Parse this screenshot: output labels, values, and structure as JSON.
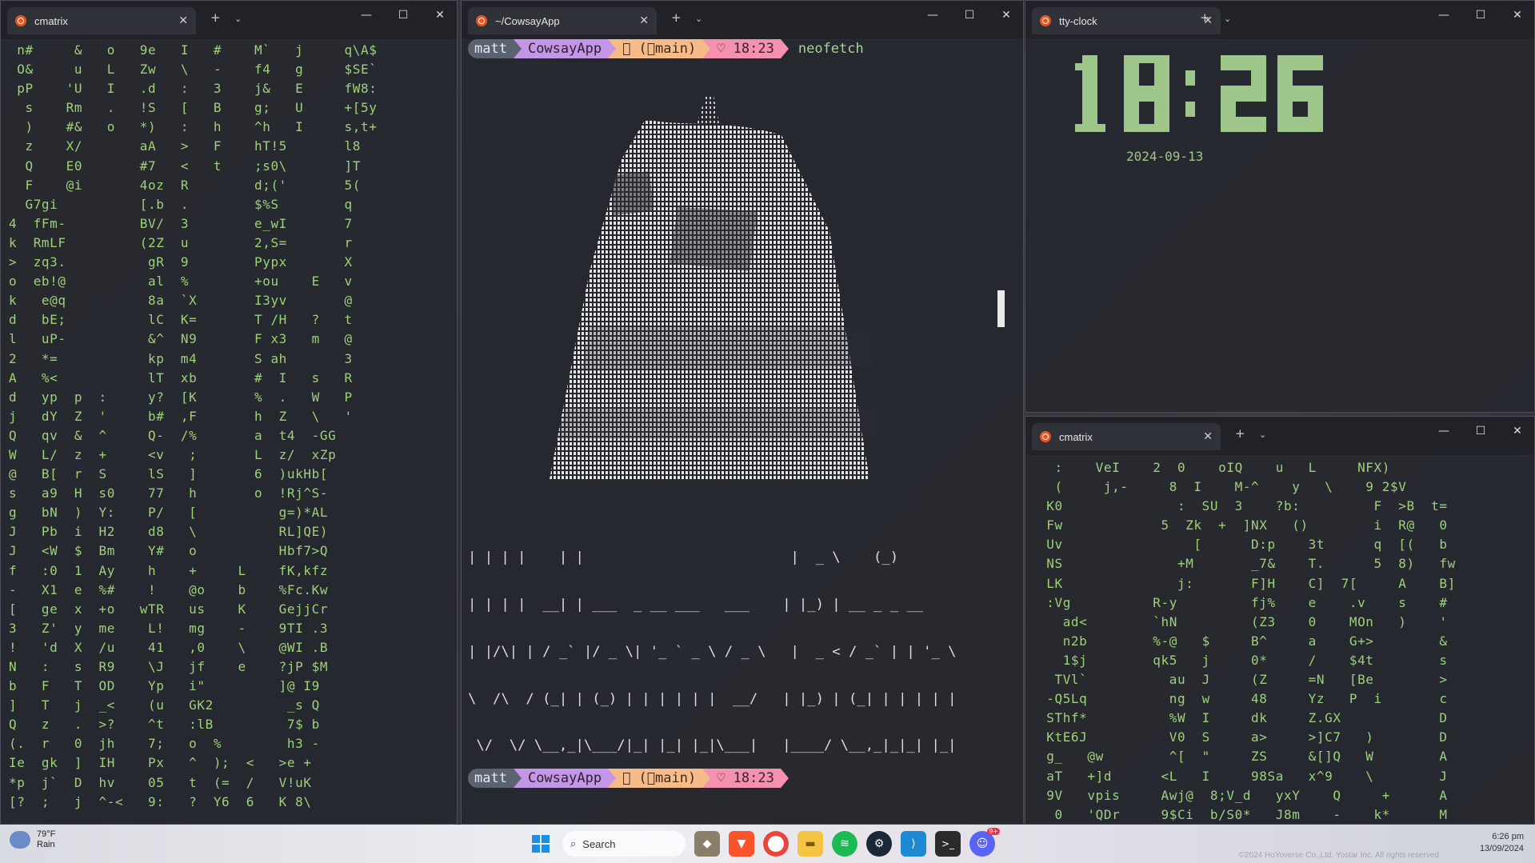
{
  "wallpaper": {
    "watermark": "©2024 HoYoverse Co.,Ltd. Yostar Inc. All rights reserved"
  },
  "windows": {
    "left": {
      "tab_title": "cmatrix",
      "lines": [
        " n#     &   o   9e   I   #    M`   j     q\\A$",
        " O&     u   L   Zw   \\   -    f4   g     $SE`",
        " pP    'U   I   .d   :   3    j&   E     fW8:",
        "  s    Rm   .   !S   [   B    g;   U     +[5y",
        "  )    #&   o   *)   :   h    ^h   I     s,t+",
        "  z    X/       aA   >   F    hT!5       l8",
        "  Q    E0       #7   <   t    ;s0\\       ]T",
        "  F    @i       4oz  R        d;('       5(",
        "  G7gi          [.b  .        $%S        q",
        "4  fFm-         BV/  3        e_wI       7",
        "k  RmLF         (2Z  u        2,S=       r",
        ">  zq3.          gR  9        Pypx       X",
        "o  eb!@          al  %        +ou    E   v",
        "k   e@q          8a  `X       I3yv       @",
        "d   bE;          lC  K=       T /H   ?   t",
        "l   uP-          &^  N9       F x3   m   @",
        "2   *=           kp  m4       S ah       3",
        "A   %<           lT  xb       #  I   s   R",
        "d   yp  p  :     y?  [K       %  .   W   P",
        "j   dY  Z  '     b#  ,F       h  Z   \\   '",
        "Q   qv  &  ^     Q-  /%       a  t4  -GG",
        "W   L/  z  +     <v   ;       L  z/  xZp",
        "@   B[  r  S     lS   ]       6  )ukHb[",
        "s   a9  H  s0    77   h       o  !Rj^S-",
        "g   bN  )  Y:    P/   [          g=)*AL",
        "J   Pb  i  H2    d8   \\          RL]QE)",
        "J   <W  $  Bm    Y#   o          Hbf7>Q",
        "f   :0  1  Ay    h    +     L    fK,kfz",
        "-   X1  e  %#    !    @o    b    %Fc.Kw",
        "[   ge  x  +o   wTR   us    K    GejjCr",
        "3   Z'  y  me    L!   mg    -    9TI .3",
        "!   'd  X  /u    41   ,0    \\    @WI .B",
        "N   :   s  R9    \\J   jf    e    ?jP $M",
        "b   F   T  OD    Yp   i\"         ]@ I9",
        "]   T   j  _<    (u   GK2         _s Q",
        "Q   z   .  >?    ^t   :lB         7$ b",
        "(.  r   0  jh    7;   o  %        h3 -",
        "Ie  gk  ]  IH    Px   ^  );  <   >e +",
        "*p  j`  D  hv    05   t  (=  /   V!uK",
        "[?  ;   j  ^-<   9:   ?  Y6  6   K 8\\"
      ]
    },
    "middle": {
      "tab_title": "~/CowsayApp",
      "prompt": {
        "user": "matt",
        "dir": "CowsayApp",
        "git": " (⬡main)",
        "time": "♡ 18:23"
      },
      "command": "neofetch",
      "banner": [
        "| | | |    | |                         |  _ \\    (_)",
        "| | | |  __| | ___  _ __ ___   ___    | |_) | __ _ _ __",
        "| |/\\| | / _` |/ _ \\| '_ ` _ \\ / _ \\   |  _ < / _` | | '_ \\",
        "\\  /\\  / (_| | (_) | | | | | |  __/   | |_) | (_| | | | | |",
        " \\/  \\/ \\__,_|\\___/|_| |_| |_|\\___|   |____/ \\__,_|_|_| |_|"
      ]
    },
    "clock": {
      "tab_title": "tty-clock",
      "time": "18:26",
      "date": "2024-09-13"
    },
    "bottom_right": {
      "tab_title": "cmatrix",
      "lines": [
        "  :    VeI    2  0    oIQ    u   L     NFX)",
        "  (     j,-     8  I    M-^    y   \\    9 2$V",
        " K0              :  SU  3    ?b:         F  >B  t=",
        " Fw            5  Zk  +  ]NX   ()        i  R@   0",
        " Uv                [      D:p    3t      q  [(   b",
        " NS              +M       _7&    T.      5  8)   fw",
        " LK              j:       F]H    C]  7[     A    B]",
        " :Vg          R-y         fj%    e    .v    s    #",
        "   ad<        `hN         (Z3    0    MOn   )    '",
        "   n2b        %-@   $     B^     a    G+>        &",
        "   1$j        qk5   j     0*     /    $4t        s",
        "  TVl`          au  J     (Z     =N   [Be        >",
        " -Q5Lq          ng  w     48     Yz   P  i       c",
        " SThf*          %W  I     dk     Z.GX            D",
        " KtE6J          V0  S     a>     >]C7   )        D",
        " g_   @w        ^[  \"     ZS     &[]Q   W        A",
        " aT   +]d      <L   I     98Sa   x^9    \\        J",
        " 9V   vpis     Awj@  8;V_d   yxY    Q     +      A",
        "  0   'QDr     9$Ci  b/S0*   J8m    -    k*      M"
      ]
    }
  },
  "taskbar": {
    "weather_temp": "79°F",
    "weather_desc": "Rain",
    "search_placeholder": "Search",
    "time": "6:26 pm",
    "date": "13/09/2024",
    "discord_badge": "9+"
  }
}
